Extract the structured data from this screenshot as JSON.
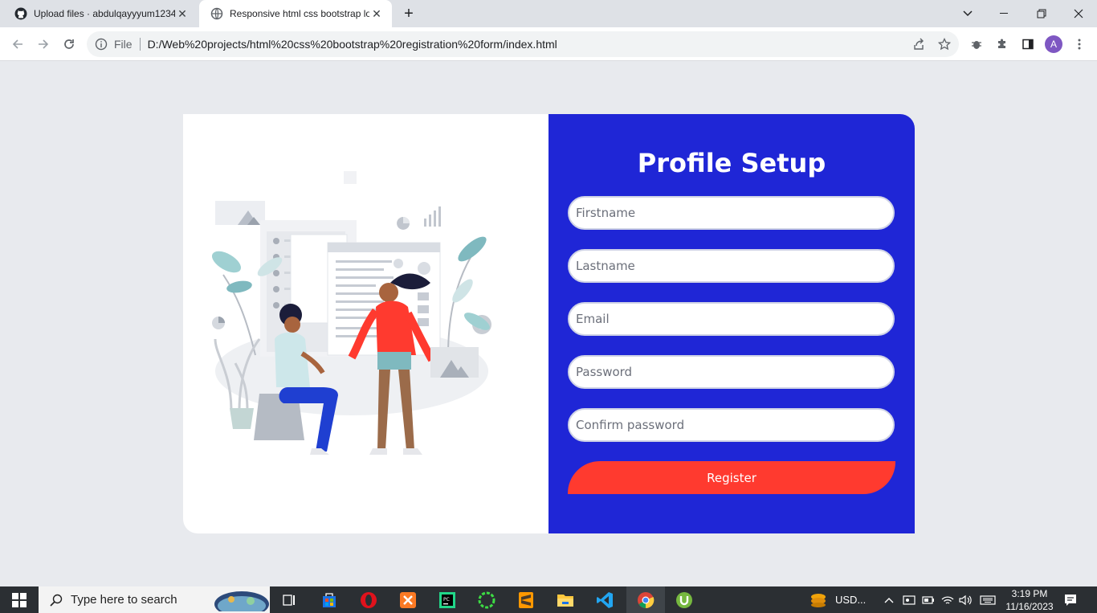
{
  "browser": {
    "tabs": [
      {
        "label": "Upload files · abdulqayyyum1234",
        "icon": "github-icon"
      },
      {
        "label": "Responsive html css bootstrap lo",
        "icon": "globe-icon"
      }
    ],
    "scheme_label": "File",
    "url": "D:/Web%20projects/html%20css%20bootstrap%20registration%20form/index.html",
    "avatar_letter": "A"
  },
  "form": {
    "title": "Profile Setup",
    "fields": [
      {
        "placeholder": "Firstname"
      },
      {
        "placeholder": "Lastname"
      },
      {
        "placeholder": "Email"
      },
      {
        "placeholder": "Password"
      },
      {
        "placeholder": "Confirm password"
      }
    ],
    "submit_label": "Register"
  },
  "colors": {
    "form_bg": "#1f26d6",
    "submit_bg": "#ff3a2f",
    "page_bg": "#e8eaee"
  },
  "taskbar": {
    "search_placeholder": "Type here to search",
    "tray_label": "USD...",
    "time": "3:19 PM",
    "date": "11/16/2023"
  }
}
